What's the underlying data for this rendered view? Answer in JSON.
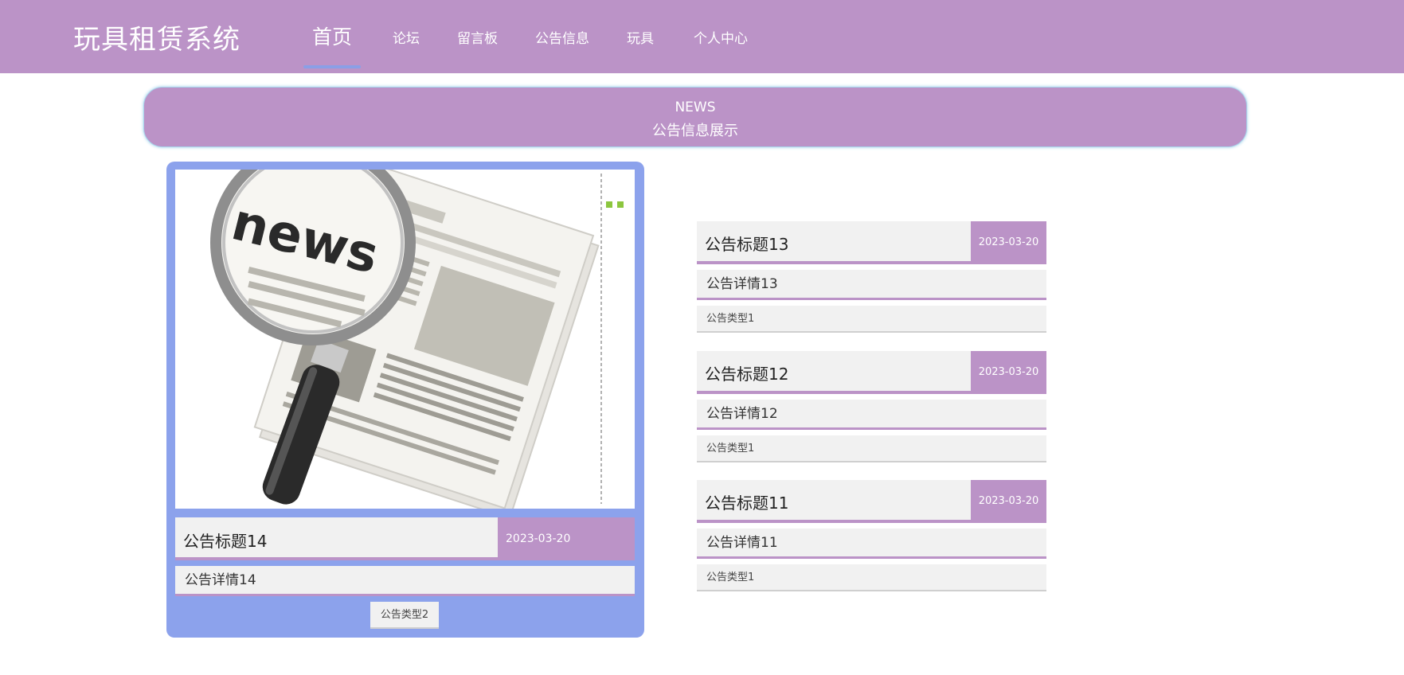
{
  "header": {
    "brand": "玩具租赁系统",
    "nav": [
      {
        "label": "首页",
        "active": true
      },
      {
        "label": "论坛"
      },
      {
        "label": "留言板"
      },
      {
        "label": "公告信息"
      },
      {
        "label": "玩具"
      },
      {
        "label": "个人中心"
      }
    ]
  },
  "banner": {
    "en": "NEWS",
    "cn": "公告信息展示"
  },
  "featured": {
    "image_text": "news",
    "title": "公告标题14",
    "date": "2023-03-20",
    "detail": "公告详情14",
    "type": "公告类型2"
  },
  "notices": [
    {
      "title": "公告标题13",
      "date": "2023-03-20",
      "detail": "公告详情13",
      "type": "公告类型1"
    },
    {
      "title": "公告标题12",
      "date": "2023-03-20",
      "detail": "公告详情12",
      "type": "公告类型1"
    },
    {
      "title": "公告标题11",
      "date": "2023-03-20",
      "detail": "公告详情11",
      "type": "公告类型1"
    }
  ],
  "colors": {
    "primary": "#bb93c7",
    "accent": "#8ca2ec",
    "panel": "#f1f1f1"
  }
}
